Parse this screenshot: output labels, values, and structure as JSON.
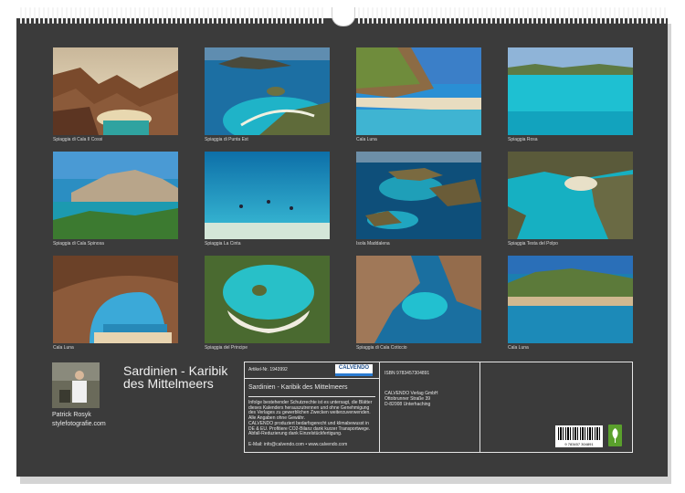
{
  "calendar": {
    "title": "Sardinien - Karibik des Mittelmeers",
    "photos": [
      {
        "caption": "Spiaggia di Cala Il Cossi"
      },
      {
        "caption": "Spiaggia di Punta Est"
      },
      {
        "caption": "Cala Luna"
      },
      {
        "caption": "Spiaggia Rosa"
      },
      {
        "caption": "Spiaggia di Cala Spinosa"
      },
      {
        "caption": "Spiaggia La Cinta"
      },
      {
        "caption": "Isola Maddalena"
      },
      {
        "caption": "Spiaggia Testa del Polpo"
      },
      {
        "caption": "Cala Luna"
      },
      {
        "caption": "Spiaggia del Principe"
      },
      {
        "caption": "Spiaggia di Cala Coticcio"
      },
      {
        "caption": "Cala Luna"
      }
    ]
  },
  "author": {
    "name": "Patrick Rosyk",
    "website": "stylefotografie.com"
  },
  "info": {
    "article_no": "Artikel-Nr. 1943992",
    "logo_text": "CALVENDO",
    "product_title": "Sardinien - Karibik des Mittelmeers",
    "copyright": "Infolge bestehender Schutzrechte ist es untersagt, die Blätter dieses Kalenders herauszutrennen und ohne Genehmigung des Verlages zu gewerblichen Zwecken weiterzuverwenden. Alle Angaben ohne Gewähr.",
    "climate": "CALVENDO produziert bedarfsgerecht und klimabewusst in DE & EU. Profitiere CO2-Bilanz dank kurzer Transportwege. Abfall-Reduzierung dank Einzelstückfertigung.",
    "email": "E-Mail: info@calvendo.com • www.calvendo.com",
    "isbn": "ISBN 9783457304891",
    "publisher": "CALVENDO Verlag GmbH",
    "street": "Ottobrunner Straße 39",
    "city": "D-82008 Unterhaching",
    "barcode_number": "9 783457 304891"
  }
}
